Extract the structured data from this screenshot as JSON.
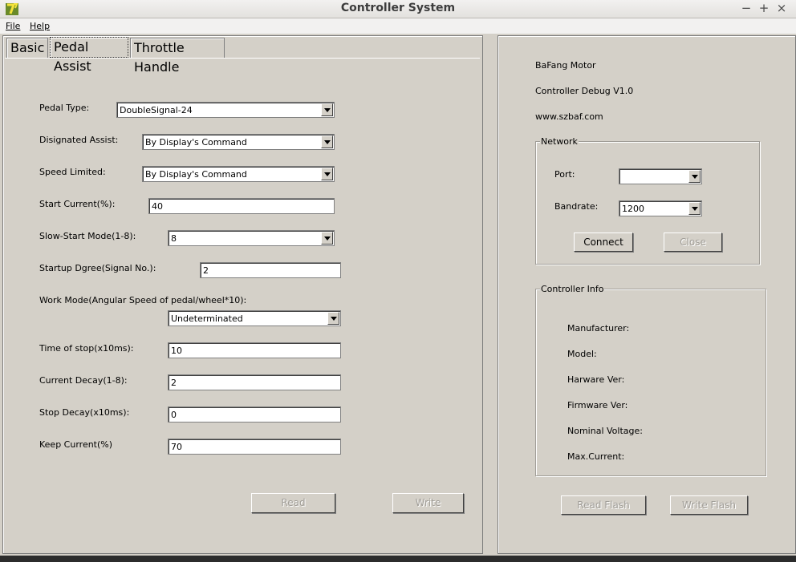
{
  "window": {
    "title": "Controller System",
    "controls": {
      "minimize": "−",
      "maximize": "+",
      "close": "×"
    }
  },
  "menu": {
    "file": "File",
    "help": "Help"
  },
  "tabs": [
    "Basic",
    "Pedal Assist",
    "Throttle Handle"
  ],
  "form": {
    "pedal_type": {
      "label": "Pedal Type:",
      "value": "DoubleSignal-24"
    },
    "designated_assist": {
      "label": "Disignated Assist:",
      "value": "By Display's Command"
    },
    "speed_limited": {
      "label": "Speed Limited:",
      "value": "By Display's Command"
    },
    "start_current": {
      "label": "Start Current(%):",
      "value": "40"
    },
    "slow_start_mode": {
      "label": "Slow-Start Mode(1-8):",
      "value": "8"
    },
    "startup_degree": {
      "label": "Startup Dgree(Signal No.):",
      "value": "2"
    },
    "work_mode": {
      "label": "Work Mode(Angular Speed of pedal/wheel*10):",
      "value": "Undeterminated"
    },
    "time_of_stop": {
      "label": "Time of stop(x10ms):",
      "value": "10"
    },
    "current_decay": {
      "label": "Current Decay(1-8):",
      "value": "2"
    },
    "stop_decay": {
      "label": "Stop Decay(x10ms):",
      "value": "0"
    },
    "keep_current": {
      "label": "Keep Current(%)",
      "value": "70"
    },
    "read_button": "Read",
    "write_button": "Write"
  },
  "info": {
    "line1": "BaFang Motor",
    "line2": "Controller Debug V1.0",
    "line3": "www.szbaf.com"
  },
  "network": {
    "title": "Network",
    "port_label": "Port:",
    "port_value": "",
    "baudrate_label": "Bandrate:",
    "baudrate_value": "1200",
    "connect_button": "Connect",
    "close_button": "Close"
  },
  "controller_info": {
    "title": "Controller Info",
    "manufacturer": "Manufacturer:",
    "model": "Model:",
    "hardware_ver": "Harware Ver:",
    "firmware_ver": "Firmware Ver:",
    "nominal_voltage": "Nominal Voltage:",
    "max_current": "Max.Current:"
  },
  "flash": {
    "read": "Read Flash",
    "write": "Write Flash"
  }
}
